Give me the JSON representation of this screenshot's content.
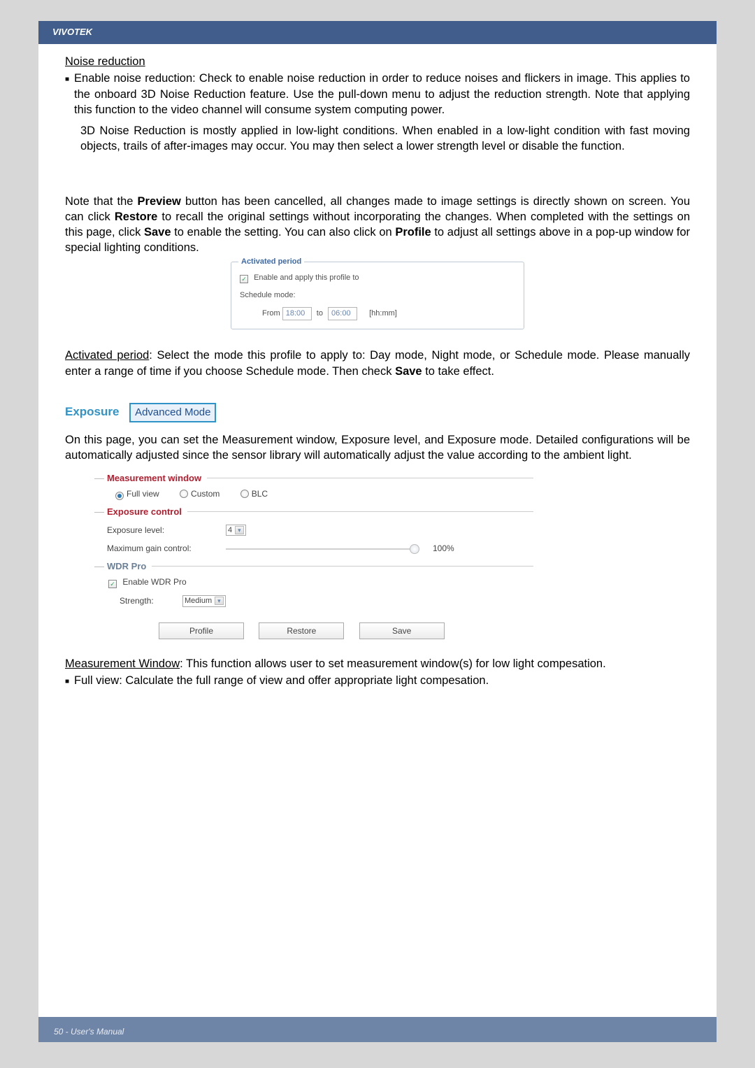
{
  "header": {
    "brand": "VIVOTEK"
  },
  "noise": {
    "heading": "Noise reduction",
    "p1": "Enable noise reduction: Check to enable noise reduction in order to reduce noises and flickers in image. This applies to the onboard 3D Noise Reduction feature. Use the pull-down menu to adjust the reduction strength. Note that applying this function to the video channel will consume system computing power.",
    "p2": "3D Noise Reduction is mostly applied in low-light conditions. When enabled in a low-light condition with fast moving objects, trails of after-images may occur. You may then select a lower strength level or disable the function."
  },
  "note": {
    "t1": "Note that the ",
    "b1": "Preview",
    "t2": " button has been cancelled, all changes made to image settings is directly shown on screen. You can click ",
    "b2": "Restore",
    "t3": " to recall the original settings without incorporating the changes. When completed with the settings on this page, click ",
    "b3": "Save",
    "t4": " to enable the setting. You can also click on ",
    "b4": "Profile",
    "t5": " to adjust all settings above in a pop-up window for special lighting conditions."
  },
  "activated": {
    "legend": "Activated period",
    "enable_label": "Enable and apply this profile to",
    "schedule_label": "Schedule mode:",
    "from_label": "From",
    "from_value": "18:00",
    "to_label": "to",
    "to_value": "06:00",
    "hint": "[hh:mm]"
  },
  "activated_text": {
    "head": "Activated period",
    "body": ": Select the mode this profile to apply to: Day mode, Night mode, or Schedule mode. Please manually enter a range of time if you choose Schedule mode. Then check ",
    "b1": "Save",
    "tail": " to take effect."
  },
  "exposure": {
    "title": "Exposure",
    "badge": "Advanced Mode",
    "intro": "On this page, you can set the Measurement window, Exposure level, and Exposure mode. Detailed configurations will be automatically adjusted since the sensor library will automatically adjust the value according to the ambient light."
  },
  "form": {
    "mw_legend": "Measurement window",
    "opt_full": "Full view",
    "opt_custom": "Custom",
    "opt_blc": "BLC",
    "ec_legend": "Exposure control",
    "exp_level_label": "Exposure level:",
    "exp_level_value": "4",
    "max_gain_label": "Maximum gain control:",
    "max_gain_pct": "100%",
    "wdr_legend": "WDR Pro",
    "enable_wdr": "Enable WDR Pro",
    "strength_label": "Strength:",
    "strength_value": "Medium",
    "btn_profile": "Profile",
    "btn_restore": "Restore",
    "btn_save": "Save"
  },
  "mw_text": {
    "head": "Measurement Window",
    "body": ": This function allows user to set measurement window(s) for low light compesation.",
    "bullet": "Full view: Calculate the full range of view and offer appropriate light compesation."
  },
  "footer": {
    "text": "50 - User's Manual"
  }
}
